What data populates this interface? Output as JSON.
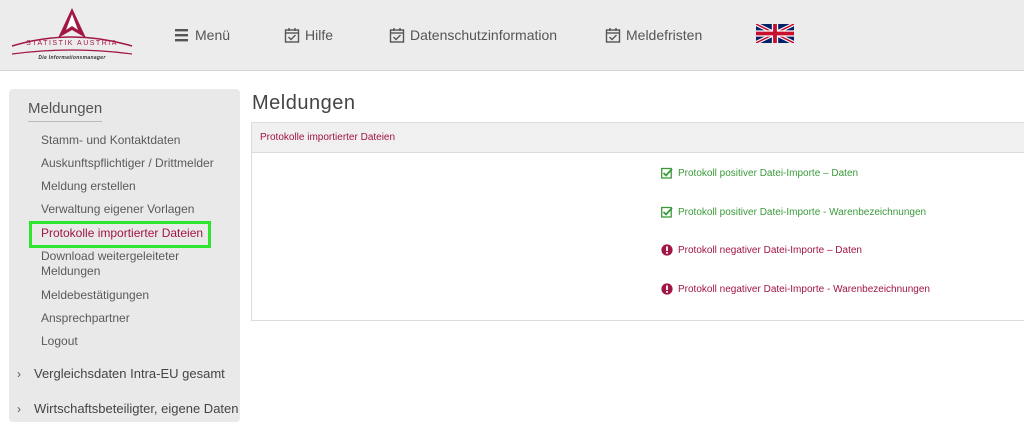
{
  "header": {
    "logo": {
      "name": "STATISTIK AUSTRIA",
      "tagline": "Die Informationsmanager",
      "icon": "statistik-austria-logo"
    },
    "nav": [
      {
        "label": "Menü",
        "icon": "hamburger-icon"
      },
      {
        "label": "Hilfe",
        "icon": "calendar-check-icon"
      },
      {
        "label": "Datenschutzinformation",
        "icon": "calendar-check-icon"
      },
      {
        "label": "Meldefristen",
        "icon": "calendar-check-icon"
      }
    ],
    "language_icon": "uk-flag-icon"
  },
  "sidebar": {
    "title": "Meldungen",
    "items": [
      {
        "label": "Stamm- und Kontaktdaten"
      },
      {
        "label": "Auskunftspflichtiger / Drittmelder"
      },
      {
        "label": "Meldung erstellen"
      },
      {
        "label": "Verwaltung eigener Vorlagen"
      },
      {
        "label": "Protokolle importierter Dateien",
        "active": true
      },
      {
        "label": "Download weitergeleiteter Meldungen"
      },
      {
        "label": "Meldebestätigungen"
      },
      {
        "label": "Ansprechpartner"
      },
      {
        "label": "Logout"
      }
    ],
    "groups": [
      {
        "label": "Vergleichsdaten Intra-EU gesamt",
        "icon": "chevron-right-icon"
      },
      {
        "label": "Wirtschaftsbeteiligter, eigene Daten",
        "icon": "chevron-right-icon"
      }
    ]
  },
  "main": {
    "title": "Meldungen",
    "panel": {
      "header": "Protokolle importierter Dateien",
      "links": [
        {
          "label": "Protokoll positiver Datei-Importe – Daten",
          "status": "positive",
          "icon": "check-square-icon"
        },
        {
          "label": "Protokoll positiver Datei-Importe - Warenbezeichnungen",
          "status": "positive",
          "icon": "check-square-icon"
        },
        {
          "label": "Protokoll negativer Datei-Importe – Daten",
          "status": "negative",
          "icon": "exclamation-circle-icon"
        },
        {
          "label": "Protokoll negativer Datei-Importe - Warenbezeichnungen",
          "status": "negative",
          "icon": "exclamation-circle-icon"
        }
      ]
    }
  },
  "colors": {
    "brand": "#a11642",
    "positive": "#3a9a3a",
    "highlight": "#2de62d",
    "header_bg": "#ececec",
    "sidebar_bg": "#e9e9e9"
  }
}
